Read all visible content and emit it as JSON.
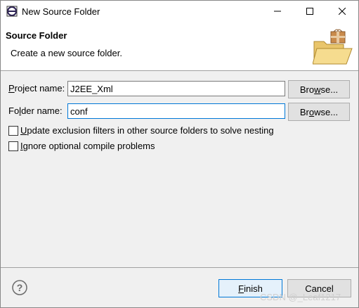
{
  "window": {
    "title": "New Source Folder",
    "minimize_glyph": "—",
    "maximize_glyph": "☐",
    "close_glyph": "✕"
  },
  "banner": {
    "title": "Source Folder",
    "description": "Create a new source folder."
  },
  "form": {
    "project_label_pre": "",
    "project_label_mnemonic": "P",
    "project_label_post": "roject name:",
    "project_value": "J2EE_Xml",
    "folder_label_pre": "Fo",
    "folder_label_mnemonic": "l",
    "folder_label_post": "der name:",
    "folder_value": "conf",
    "browse_label_pre": "Bro",
    "browse_label_mnemonic": "w",
    "browse_label_post": "se...",
    "browse2_label_pre": "Br",
    "browse2_label_mnemonic": "o",
    "browse2_label_post": "wse...",
    "checkbox_update_pre": "",
    "checkbox_update_mnemonic": "U",
    "checkbox_update_post": "pdate exclusion filters in other source folders to solve nesting",
    "checkbox_update_checked": false,
    "checkbox_ignore_pre": "",
    "checkbox_ignore_mnemonic": "I",
    "checkbox_ignore_post": "gnore optional compile problems",
    "checkbox_ignore_checked": false
  },
  "footer": {
    "help_icon": "question-circle",
    "finish_pre": "",
    "finish_mnemonic": "F",
    "finish_post": "inish",
    "cancel_label": "Cancel"
  },
  "watermark": "CSDN @_Leaf1217",
  "colors": {
    "focus_border": "#0078d7",
    "default_button_bg": "#e5f1fb",
    "dialog_bg": "#f0f0f0"
  }
}
